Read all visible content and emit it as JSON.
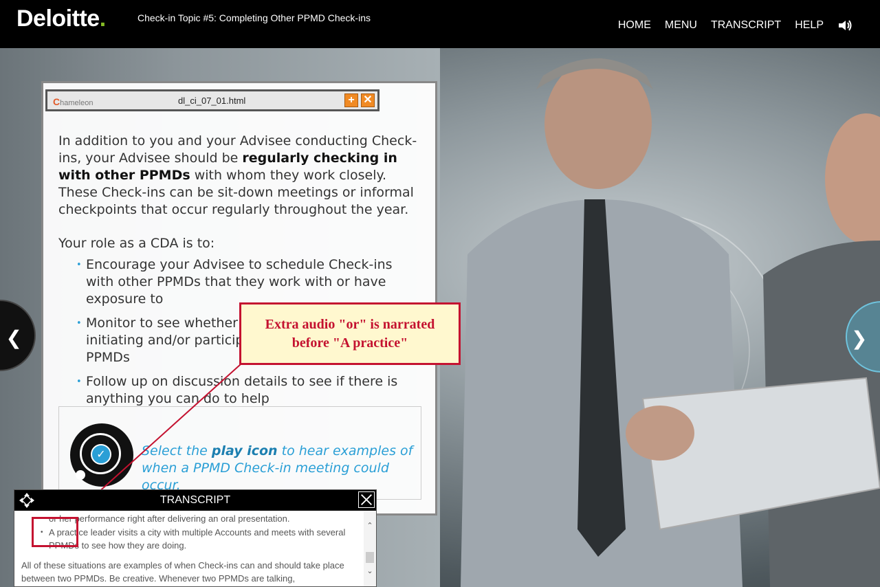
{
  "header": {
    "logo_text": "Deloitte",
    "logo_dot": ".",
    "course_title": "Check-in Topic #5: Completing Other PPMD Check-ins",
    "nav": [
      "HOME",
      "MENU",
      "TRANSCRIPT",
      "HELP"
    ],
    "speaker_icon": "speaker-icon"
  },
  "card": {
    "intro_part1": "In addition to you and your Advisee conducting Check-ins, your Advisee should be ",
    "intro_bold": "regularly checking in with other PPMDs",
    "intro_part2": " with whom they work closely. These Check-ins can be sit-down meetings or informal checkpoints that occur regularly throughout the year.",
    "role_heading": "Your role as a CDA is to:",
    "bullets": [
      "Encourage your Advisee to schedule Check-ins with other PPMDs that they work with or have exposure to",
      "Monitor to see whether c",
      "Follow up on discussion details to see if there is anything you can do to help"
    ],
    "bullet2_line2": "initiating and/or participa",
    "bullet2_line3": "PPMDs",
    "cta_prefix": "Select the ",
    "cta_bold": "play icon",
    "cta_suffix": " to hear examples of when a PPMD Check-in meeting could occur."
  },
  "chameleon": {
    "logo": "hameleon",
    "logo_c": "C",
    "filename": "dl_ci_07_01.html",
    "plus": "+",
    "close": "✕"
  },
  "callout": {
    "line1": "Extra audio \"or\" is narrated",
    "line2": "before \"A practice\""
  },
  "transcript": {
    "title": "TRANSCRIPT",
    "line1": "or her performance right after delivering an oral presentation.",
    "bullet": "A practice leader visits a city with multiple Accounts and meets with several PPMDs to see how they are doing.",
    "paragraph": "All of these situations are examples of when Check-ins can and should take place between two PPMDs. Be creative. Whenever two PPMDs are talking,"
  },
  "colors": {
    "accent_blue": "#2a9fd6",
    "deloitte_green": "#86bc25",
    "callout_red": "#c41230",
    "callout_bg": "#fff8cf"
  }
}
